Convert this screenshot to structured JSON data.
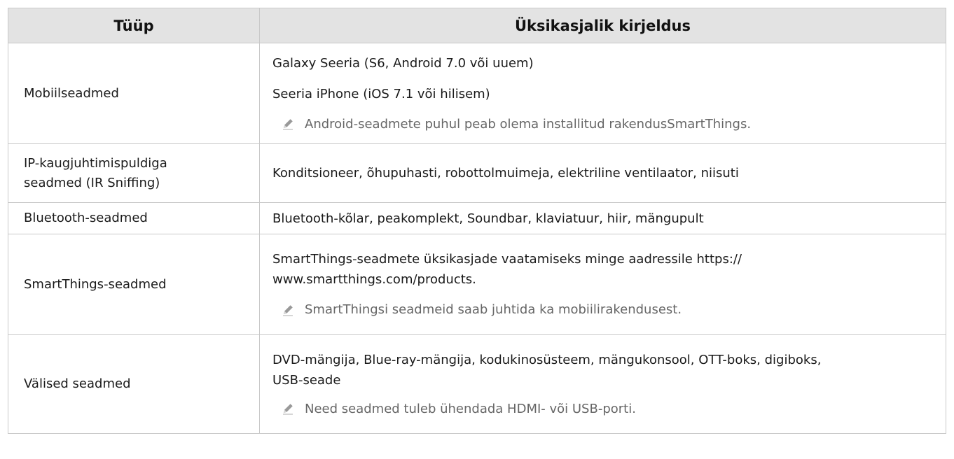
{
  "header": {
    "type_label": "Tüüp",
    "description_label": "Üksikasjalik kirjeldus"
  },
  "rows": [
    {
      "type": "Mobiilseadmed",
      "lines": [
        "Galaxy Seeria (S6, Android 7.0 või uuem)",
        "Seeria iPhone (iOS 7.1 või hilisem)"
      ],
      "note": "Android-seadmete puhul peab olema installitud rakendusSmartThings."
    },
    {
      "type_lines": [
        "IP-kaugjuhtimispuldiga",
        "seadmed (IR Sniffing)"
      ],
      "lines": [
        "Konditsioneer, õhupuhasti, robottolmuimeja, elektriline ventilaator, niisuti"
      ]
    },
    {
      "type": "Bluetooth-seadmed",
      "lines": [
        "Bluetooth-kõlar, peakomplekt, Soundbar, klaviatuur, hiir, mängupult"
      ]
    },
    {
      "type": "SmartThings-seadmed",
      "lines": [
        "SmartThings-seadmete üksikasjade vaatamiseks minge aadressile https://",
        "www.smartthings.com/products."
      ],
      "note": "SmartThingsi seadmeid saab juhtida ka mobiilirakendusest."
    },
    {
      "type": "Välised seadmed",
      "lines": [
        "DVD-mängija, Blue-ray-mängija, kodukinosüsteem, mängukonsool, OTT-boks, digiboks,",
        "USB-seade"
      ],
      "note": "Need seadmed tuleb ühendada HDMI- või USB-porti."
    }
  ],
  "icons": {
    "note": "pencil-icon"
  }
}
